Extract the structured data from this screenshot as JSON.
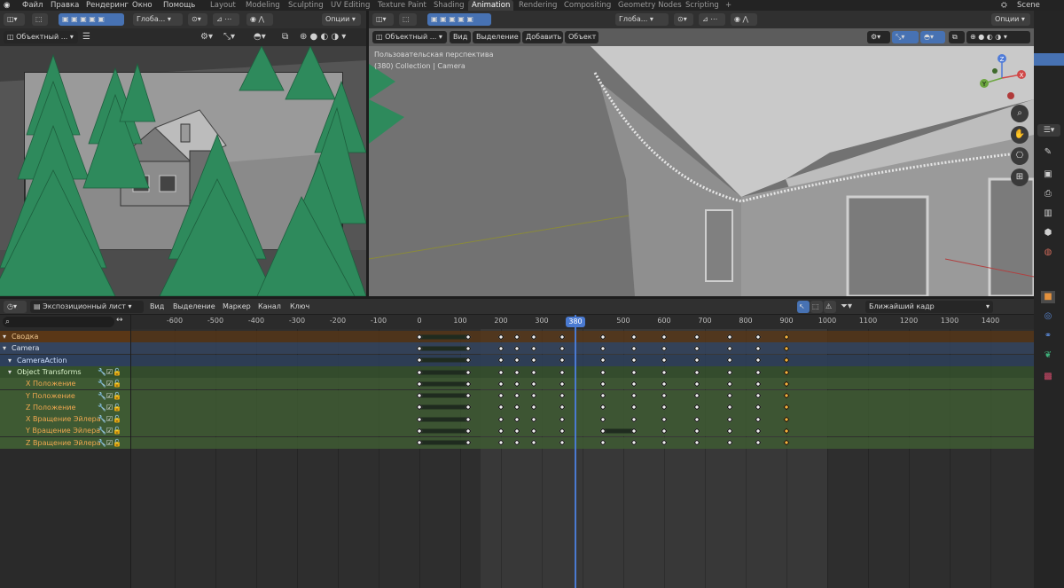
{
  "topbar": {
    "menus": [
      "Файл",
      "Правка",
      "Рендеринг",
      "Окно",
      "Помощь"
    ],
    "workspaces": [
      "Layout",
      "Modeling",
      "Sculpting",
      "UV Editing",
      "Texture Paint",
      "Shading",
      "Animation",
      "Rendering",
      "Compositing",
      "Geometry Nodes",
      "Scripting"
    ],
    "active_workspace": "Animation",
    "scene": "Scene"
  },
  "left_viewport": {
    "transform_orientation": "Глоба...",
    "options": "Опции",
    "mode": "Объектный ..."
  },
  "main_viewport": {
    "transform_orientation": "Глоба...",
    "options": "Опции",
    "mode": "Объектный ...",
    "menus": [
      "Вид",
      "Выделение",
      "Добавить",
      "Объект"
    ],
    "overlay_line1": "Пользовательская перспектива",
    "overlay_line2": "(380) Collection | Camera",
    "gizmo": {
      "z": "Z",
      "y": "Y",
      "x": "X"
    }
  },
  "dopesheet": {
    "editor_mode": "Экспозиционный лист",
    "menus": [
      "Вид",
      "Выделение",
      "Маркер",
      "Канал",
      "Ключ"
    ],
    "snap_mode": "Ближайший кадр",
    "current_frame": "380",
    "ruler_ticks": [
      "-600",
      "-500",
      "-400",
      "-300",
      "-200",
      "-100",
      "0",
      "100",
      "200",
      "300",
      "",
      "500",
      "600",
      "700",
      "800",
      "900",
      "1000",
      "1100",
      "1200",
      "1300",
      "1400"
    ],
    "channels": [
      {
        "label": "Сводка",
        "level": 0,
        "type": "summary"
      },
      {
        "label": "Camera",
        "level": 0,
        "type": "object"
      },
      {
        "label": "CameraAction",
        "level": 1,
        "type": "action"
      },
      {
        "label": "Object Transforms",
        "level": 1,
        "type": "group"
      },
      {
        "label": "X Положение",
        "level": 2,
        "type": "fcurve"
      },
      {
        "label": "Y Положение",
        "level": 2,
        "type": "fcurve"
      },
      {
        "label": "Z Положение",
        "level": 2,
        "type": "fcurve"
      },
      {
        "label": "X Вращение Эйлера",
        "level": 2,
        "type": "fcurve"
      },
      {
        "label": "Y Вращение Эйлера",
        "level": 2,
        "type": "fcurve"
      },
      {
        "label": "Z Вращение Эйлера",
        "level": 2,
        "type": "fcurve"
      }
    ],
    "keyframes": [
      0,
      120,
      200,
      240,
      280,
      350,
      450,
      525,
      600,
      680,
      760,
      830,
      900
    ],
    "selected_keyframe": 900
  },
  "colors": {
    "summary_row": "#5a3716",
    "object_row": "#34445e",
    "action_row": "#2d3f5b",
    "group_row": "#34502c",
    "fcurve_row": "#3e5a33",
    "accent": "#4772b3",
    "keyframe_selected": "#f6b13b"
  }
}
